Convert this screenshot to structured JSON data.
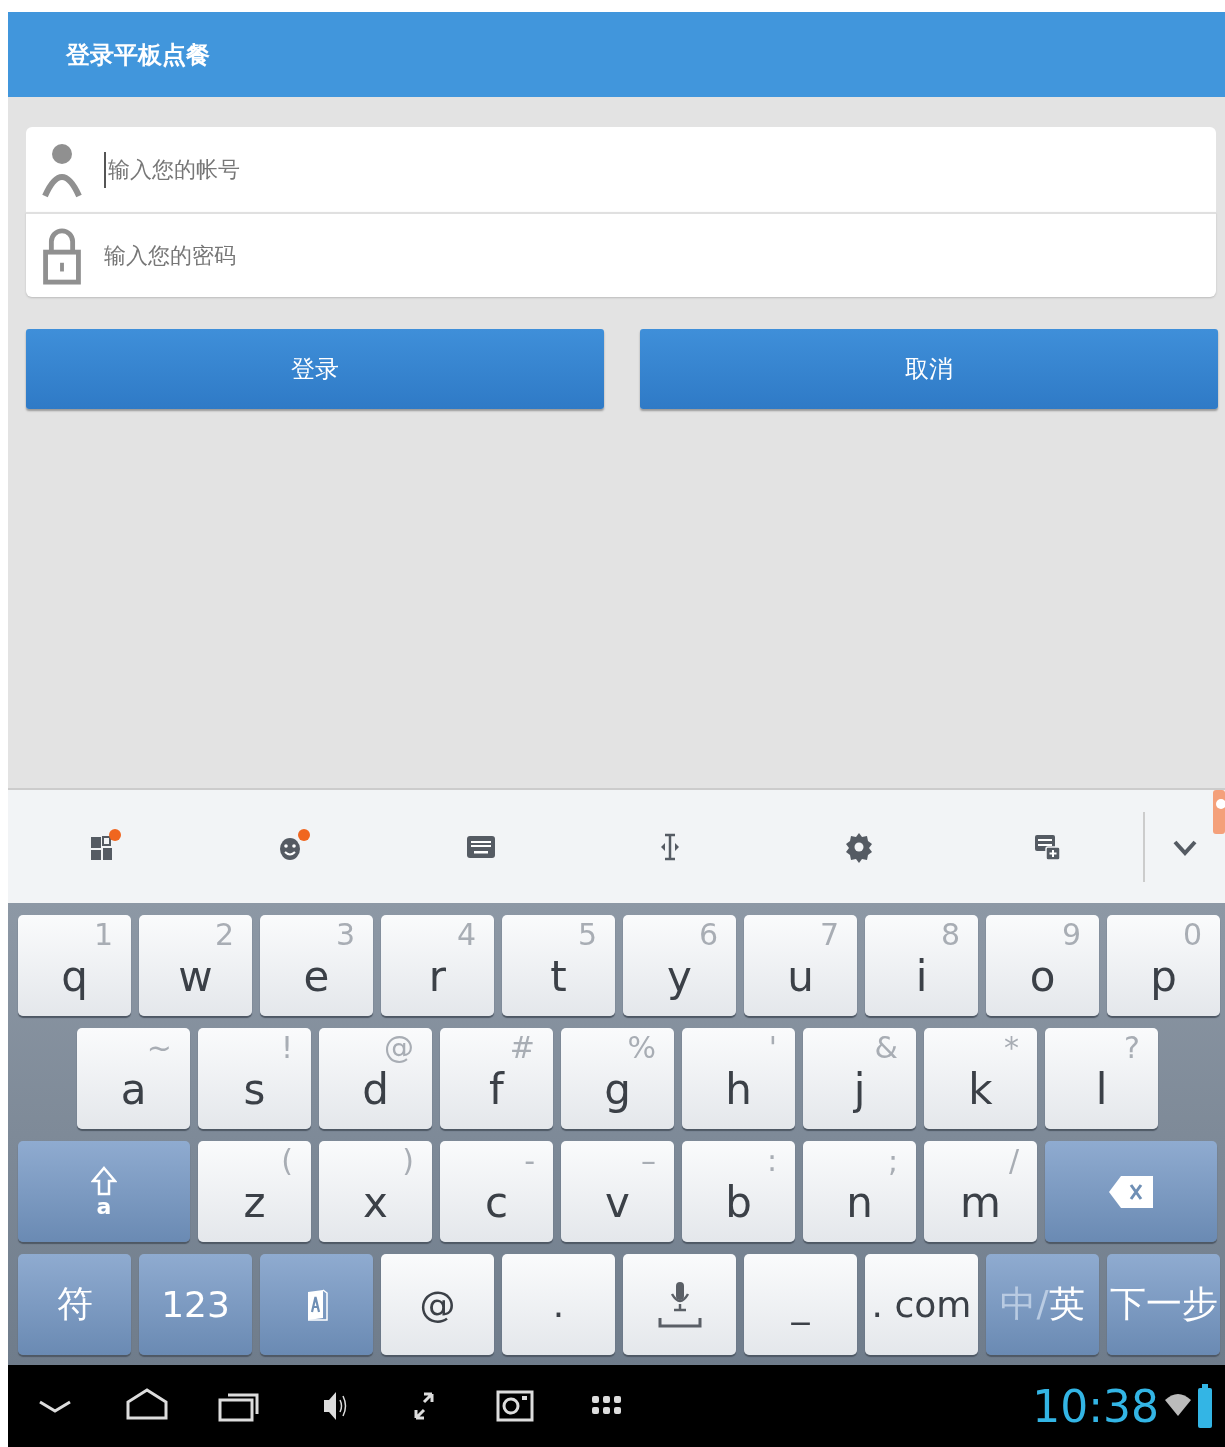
{
  "app_bar": {
    "title": "登录平板点餐"
  },
  "login_form": {
    "fields": [
      {
        "kind": "account",
        "placeholder": "输入您的帐号",
        "focused": true
      },
      {
        "kind": "password",
        "placeholder": "输入您的密码",
        "focused": false
      }
    ],
    "buttons": [
      "登录",
      "取消"
    ]
  },
  "keyboard_toolbar": {
    "items": [
      {
        "kind": "layout",
        "badge": true
      },
      {
        "kind": "emoji",
        "badge": true
      },
      {
        "kind": "keyboard",
        "badge": false
      },
      {
        "kind": "cursor",
        "badge": false
      },
      {
        "kind": "settings",
        "badge": false
      },
      {
        "kind": "switch",
        "badge": false
      },
      {
        "kind": "collapse",
        "badge": false
      }
    ]
  },
  "keyboard": {
    "rows": [
      [
        {
          "kind": "letter",
          "label": "q",
          "alt": "1"
        },
        {
          "kind": "letter",
          "label": "w",
          "alt": "2"
        },
        {
          "kind": "letter",
          "label": "e",
          "alt": "3"
        },
        {
          "kind": "letter",
          "label": "r",
          "alt": "4"
        },
        {
          "kind": "letter",
          "label": "t",
          "alt": "5"
        },
        {
          "kind": "letter",
          "label": "y",
          "alt": "6"
        },
        {
          "kind": "letter",
          "label": "u",
          "alt": "7"
        },
        {
          "kind": "letter",
          "label": "i",
          "alt": "8"
        },
        {
          "kind": "letter",
          "label": "o",
          "alt": "9"
        },
        {
          "kind": "letter",
          "label": "p",
          "alt": "0"
        }
      ],
      [
        {
          "kind": "letter",
          "label": "a",
          "alt": "~"
        },
        {
          "kind": "letter",
          "label": "s",
          "alt": "!"
        },
        {
          "kind": "letter",
          "label": "d",
          "alt": "@"
        },
        {
          "kind": "letter",
          "label": "f",
          "alt": "#"
        },
        {
          "kind": "letter",
          "label": "g",
          "alt": "%"
        },
        {
          "kind": "letter",
          "label": "h",
          "alt": "'"
        },
        {
          "kind": "letter",
          "label": "j",
          "alt": "&"
        },
        {
          "kind": "letter",
          "label": "k",
          "alt": "*"
        },
        {
          "kind": "letter",
          "label": "l",
          "alt": "?"
        }
      ],
      [
        {
          "kind": "shift",
          "label": "a"
        },
        {
          "kind": "letter",
          "label": "z",
          "alt": "("
        },
        {
          "kind": "letter",
          "label": "x",
          "alt": ")"
        },
        {
          "kind": "letter",
          "label": "c",
          "alt": "-"
        },
        {
          "kind": "letter",
          "label": "v",
          "alt": "–"
        },
        {
          "kind": "letter",
          "label": "b",
          "alt": ":"
        },
        {
          "kind": "letter",
          "label": "n",
          "alt": ";"
        },
        {
          "kind": "letter",
          "label": "m",
          "alt": "/"
        },
        {
          "kind": "backspace"
        }
      ],
      [
        {
          "kind": "function",
          "label": "符"
        },
        {
          "kind": "function",
          "label": "123"
        },
        {
          "kind": "input-mode"
        },
        {
          "kind": "symbol",
          "label": "@"
        },
        {
          "kind": "symbol",
          "label": "."
        },
        {
          "kind": "voice"
        },
        {
          "kind": "symbol",
          "label": "_"
        },
        {
          "kind": "symbol",
          "label": ". com"
        },
        {
          "kind": "language",
          "inactive": "中",
          "separator": "/",
          "active": "英"
        },
        {
          "kind": "function",
          "label": "下一步"
        }
      ]
    ]
  },
  "status_bar": {
    "time": "10:38"
  }
}
